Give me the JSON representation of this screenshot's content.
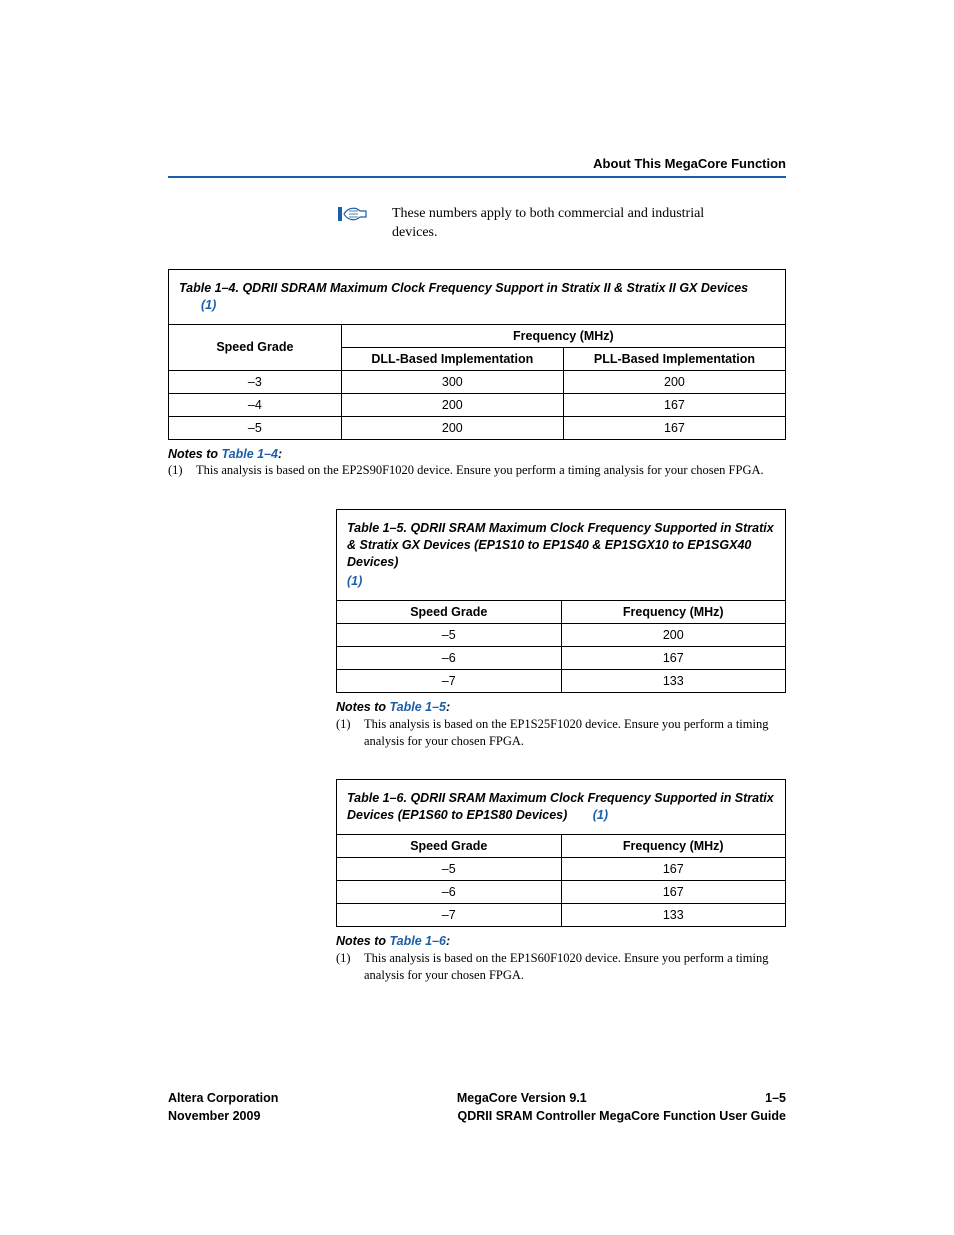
{
  "header": {
    "section_title": "About This MegaCore Function"
  },
  "note": {
    "text": "These numbers apply to both commercial and industrial devices."
  },
  "table14": {
    "caption": "Table 1–4. QDRII SDRAM Maximum Clock Frequency Support in Stratix II & Stratix II GX Devices",
    "ref": "(1)",
    "col_speed": "Speed Grade",
    "col_freq": "Frequency (MHz)",
    "col_dll": "DLL-Based Implementation",
    "col_pll": "PLL-Based Implementation",
    "rows": [
      {
        "grade": "–3",
        "dll": "300",
        "pll": "200"
      },
      {
        "grade": "–4",
        "dll": "200",
        "pll": "167"
      },
      {
        "grade": "–5",
        "dll": "200",
        "pll": "167"
      }
    ],
    "notes_heading_prefix": "Notes to ",
    "notes_heading_link": "Table 1–4",
    "notes_heading_suffix": ":",
    "note1_num": "(1)",
    "note1_text": "This analysis is based on the EP2S90F1020 device. Ensure you perform a timing analysis for your chosen FPGA."
  },
  "table15": {
    "caption": "Table 1–5. QDRII SRAM Maximum Clock Frequency Supported in Stratix & Stratix GX Devices (EP1S10 to EP1S40 & EP1SGX10 to EP1SGX40 Devices)",
    "ref": "(1)",
    "col_speed": "Speed Grade",
    "col_freq": "Frequency (MHz)",
    "rows": [
      {
        "grade": "–5",
        "freq": "200"
      },
      {
        "grade": "–6",
        "freq": "167"
      },
      {
        "grade": "–7",
        "freq": "133"
      }
    ],
    "notes_heading_prefix": "Notes to ",
    "notes_heading_link": "Table 1–5",
    "notes_heading_suffix": ":",
    "note1_num": "(1)",
    "note1_text": "This analysis is based on the EP1S25F1020 device. Ensure you perform a timing analysis for your chosen FPGA."
  },
  "table16": {
    "caption": "Table 1–6. QDRII SRAM Maximum Clock Frequency Supported in Stratix Devices (EP1S60 to EP1S80 Devices)",
    "ref": "(1)",
    "col_speed": "Speed Grade",
    "col_freq": "Frequency (MHz)",
    "rows": [
      {
        "grade": "–5",
        "freq": "167"
      },
      {
        "grade": "–6",
        "freq": "167"
      },
      {
        "grade": "–7",
        "freq": "133"
      }
    ],
    "notes_heading_prefix": "Notes to ",
    "notes_heading_link": "Table 1–6",
    "notes_heading_suffix": ":",
    "note1_num": "(1)",
    "note1_text": "This analysis is based on the EP1S60F1020 device. Ensure you perform a timing analysis for your chosen FPGA."
  },
  "footer": {
    "left1": "Altera Corporation",
    "center1": "MegaCore Version 9.1",
    "right1": "1–5",
    "left2": "November 2009",
    "right2": "QDRII SRAM Controller MegaCore Function User Guide"
  },
  "chart_data": [
    {
      "type": "table",
      "title": "Table 1–4. QDRII SDRAM Maximum Clock Frequency Support in Stratix II & Stratix II GX Devices",
      "columns": [
        "Speed Grade",
        "DLL-Based Implementation (MHz)",
        "PLL-Based Implementation (MHz)"
      ],
      "rows": [
        [
          "-3",
          300,
          200
        ],
        [
          "-4",
          200,
          167
        ],
        [
          "-5",
          200,
          167
        ]
      ]
    },
    {
      "type": "table",
      "title": "Table 1–5. QDRII SRAM Maximum Clock Frequency Supported in Stratix & Stratix GX Devices (EP1S10 to EP1S40 & EP1SGX10 to EP1SGX40 Devices)",
      "columns": [
        "Speed Grade",
        "Frequency (MHz)"
      ],
      "rows": [
        [
          "-5",
          200
        ],
        [
          "-6",
          167
        ],
        [
          "-7",
          133
        ]
      ]
    },
    {
      "type": "table",
      "title": "Table 1–6. QDRII SRAM Maximum Clock Frequency Supported in Stratix Devices (EP1S60 to EP1S80 Devices)",
      "columns": [
        "Speed Grade",
        "Frequency (MHz)"
      ],
      "rows": [
        [
          "-5",
          167
        ],
        [
          "-6",
          167
        ],
        [
          "-7",
          133
        ]
      ]
    }
  ]
}
